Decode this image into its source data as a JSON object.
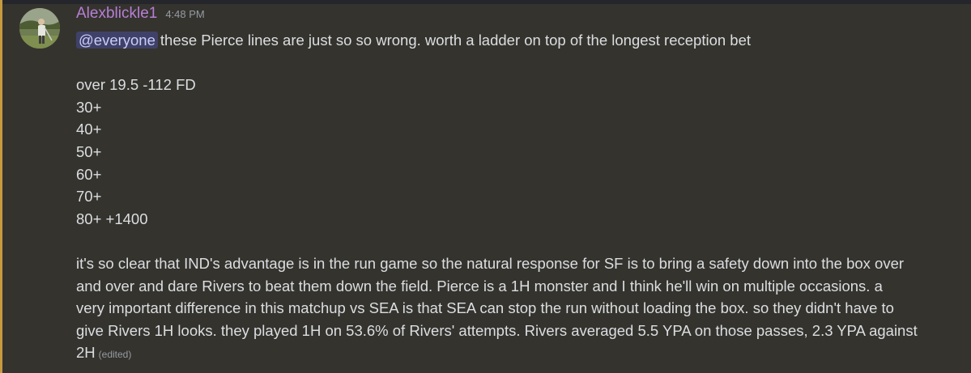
{
  "message": {
    "author": "Alexblickle1",
    "timestamp": "4:48 PM",
    "mention": "@everyone",
    "intro": "these Pierce lines are just so so wrong. worth a ladder on top of the longest reception bet",
    "ladder": [
      "over 19.5 -112 FD",
      "30+",
      "40+",
      "50+",
      "60+",
      "70+",
      "80+ +1400"
    ],
    "analysis_lines": [
      "it's so clear that IND's advantage is in the run game so the natural response for SF is to bring a safety down into the box over",
      "and over and dare Rivers to beat them down the field. Pierce is a 1H monster and I think he'll win on multiple occasions. a",
      "very important difference in this matchup vs SEA is that SEA can stop the run without loading the box. so they didn't have to",
      "give Rivers 1H looks. they played 1H on 53.6% of Rivers' attempts. Rivers averaged 5.5 YPA on those passes, 2.3 YPA against"
    ],
    "analysis_tail": "2H",
    "edited_label": "(edited)"
  },
  "colors": {
    "background": "#35332e",
    "highlight_bar": "#c69a3e",
    "username": "#b77fd6",
    "mention_bg": "#5865f2"
  },
  "icons": {
    "avatar": "user-avatar-golfer"
  }
}
